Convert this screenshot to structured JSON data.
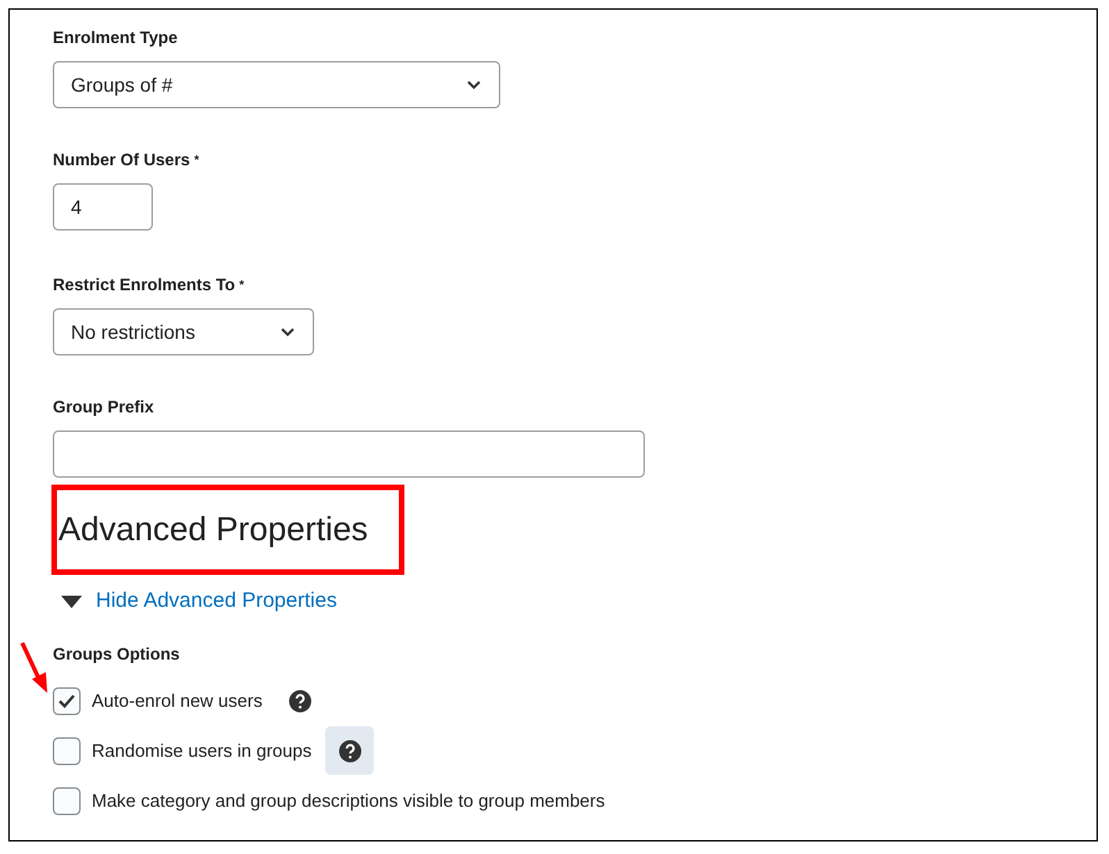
{
  "fields": [
    {
      "kind": "select",
      "label": "Enrolment Type",
      "value": "Groups of #"
    },
    {
      "kind": "input",
      "label": "Number Of Users",
      "required_mark": "*",
      "value": "4"
    },
    {
      "kind": "select",
      "label": "Restrict Enrolments To",
      "required_mark": "*",
      "value": "No restrictions"
    },
    {
      "kind": "input",
      "label": "Group Prefix"
    }
  ],
  "advanced": {
    "heading": "Advanced Properties",
    "highlighted": true,
    "toggle": "Hide Advanced Properties",
    "expanded": true
  },
  "groups_options": {
    "label": "Groups Options",
    "options": [
      {
        "label": "Auto-enrol new users",
        "checked": true,
        "help": true,
        "help_focused": false,
        "arrow": true
      },
      {
        "label": "Randomise users in groups",
        "checked": false,
        "help": true,
        "help_focused": true,
        "arrow": false
      },
      {
        "label": "Make category and group descriptions visible to group members",
        "checked": false,
        "help": false,
        "arrow": false
      }
    ]
  }
}
